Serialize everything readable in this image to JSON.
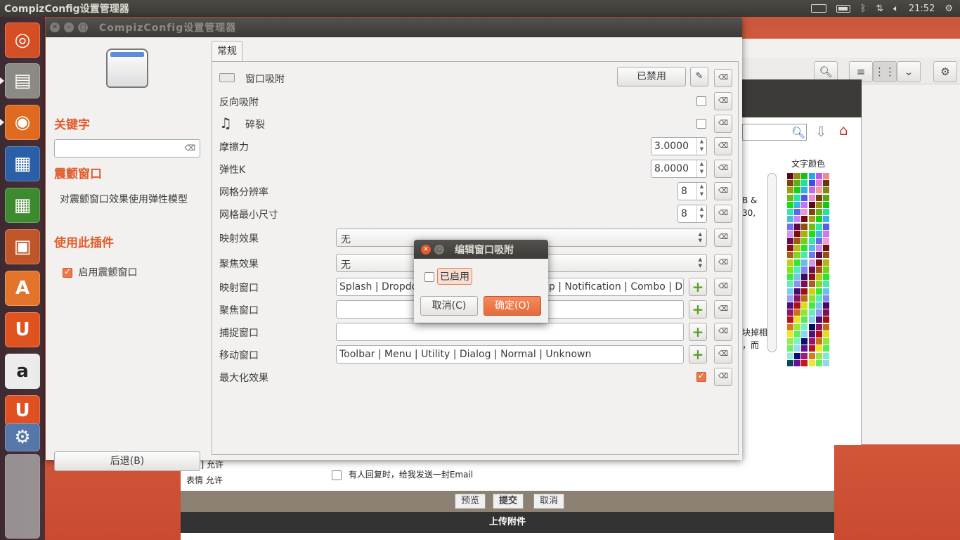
{
  "topbar": {
    "app_title": "CompizConfig设置管理器",
    "time": "21:52"
  },
  "window": {
    "title": "CompizConfig设置管理器",
    "left": {
      "keyword_heading": "关键字",
      "plugin_heading": "震颤窗口",
      "plugin_desc": "对震颤窗口效果使用弹性模型",
      "use_heading": "使用此插件",
      "enable_label": "启用震颤窗口",
      "back_button": "后退(B)"
    },
    "tab": "常规",
    "settings": {
      "snap_label": "窗口吸附",
      "snap_button": "已禁用",
      "reverse_snap_label": "反向吸附",
      "crack_label": "碎裂",
      "friction_label": "摩擦力",
      "friction_value": "3.0000",
      "spring_label": "弹性K",
      "spring_value": "8.0000",
      "grid_res_label": "网格分辨率",
      "grid_res_value": "8",
      "grid_min_label": "网格最小尺寸",
      "grid_min_value": "8",
      "map_effect_label": "映射效果",
      "map_effect_value": "无",
      "focus_effect_label": "聚焦效果",
      "focus_effect_value": "无",
      "map_window_label": "映射窗口",
      "map_window_value": "Splash | Dropdo",
      "map_window_value_tail": "ip | Notification | Combo | Dn",
      "focus_window_label": "聚焦窗口",
      "grab_window_label": "捕捉窗口",
      "move_window_label": "移动窗口",
      "move_window_value": "Toolbar | Menu | Utility | Dialog | Normal | Unknown",
      "maximize_label": "最大化效果"
    }
  },
  "dialog": {
    "title": "编辑窗口吸附",
    "enabled_label": "已启用",
    "cancel": "取消(C)",
    "ok": "确定(O)"
  },
  "background": {
    "color_heading": "文字颜色",
    "text_fragments": [
      "B &",
      "30,",
      "块掉相",
      "，而"
    ],
    "url_row": "[url] 允许",
    "emoji_row": "表情 允许",
    "email_row": "有人回复时，给我发送一封Email",
    "preview": "预览",
    "submit": "提交",
    "cancel": "取消",
    "upload": "上传附件"
  },
  "colors": {
    "accent": "#e05b2b",
    "title_bar": "#3c3b37",
    "launcher": "#3d2a31"
  }
}
